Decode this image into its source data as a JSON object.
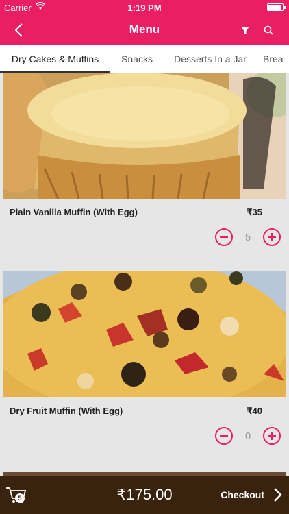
{
  "status_bar": {
    "carrier": "Carrier",
    "time": "1:19 PM",
    "battery_level": 0.95
  },
  "nav": {
    "title": "Menu"
  },
  "tabs": [
    {
      "label": "Dry Cakes & Muffins",
      "active": true
    },
    {
      "label": "Snacks",
      "active": false
    },
    {
      "label": "Desserts In a Jar",
      "active": false
    },
    {
      "label": "Brea",
      "active": false
    }
  ],
  "products": [
    {
      "name": "Plain Vanilla Muffin (With Egg)",
      "price": "₹35",
      "quantity": "5"
    },
    {
      "name": "Dry Fruit Muffin (With Egg)",
      "price": "₹40",
      "quantity": "0"
    }
  ],
  "cart": {
    "count": "5",
    "total": "₹175.00",
    "checkout_label": "Checkout"
  },
  "colors": {
    "accent": "#e91e63",
    "bottom_bar": "#3a230e",
    "card_bg": "#e6e6e6"
  },
  "icons": [
    "wifi-icon",
    "back-chevron-icon",
    "filter-icon",
    "search-icon",
    "cart-icon",
    "chevron-right-icon",
    "minus-icon",
    "plus-icon"
  ]
}
